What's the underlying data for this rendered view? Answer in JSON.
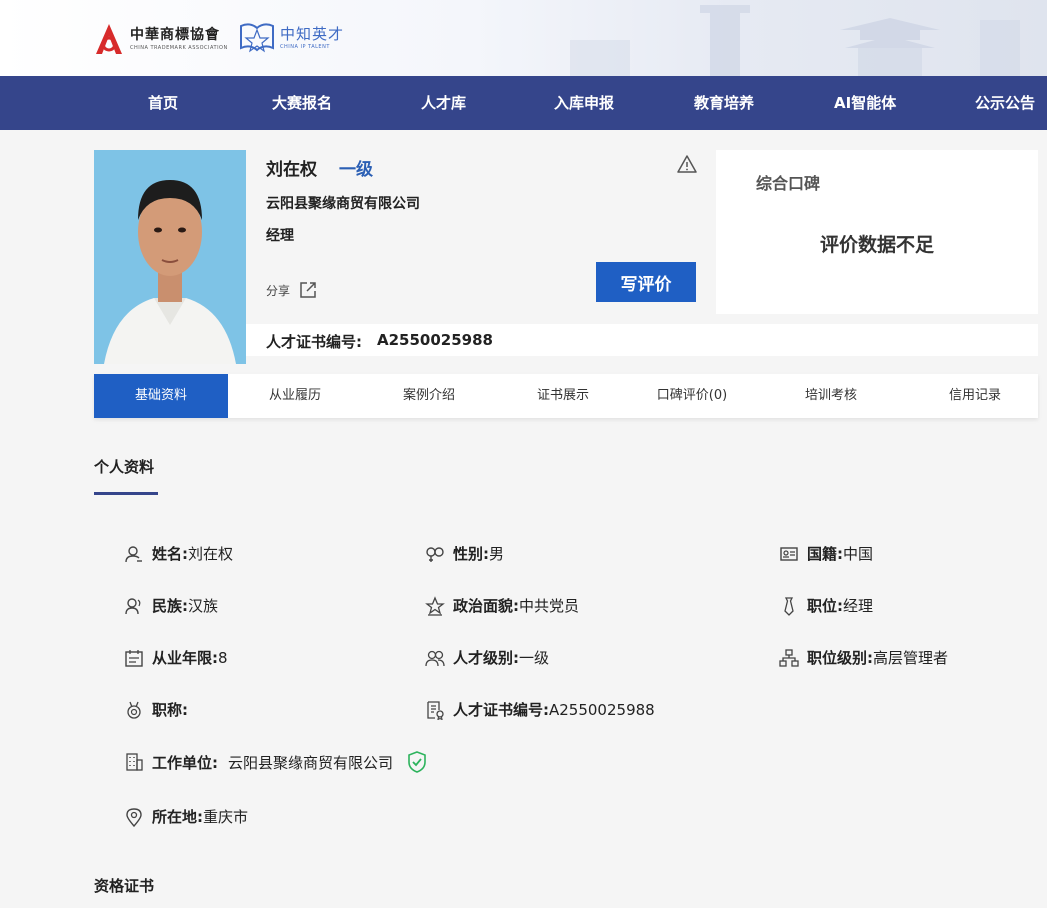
{
  "header": {
    "logo1_cn": "中華商標協會",
    "logo1_en": "CHINA TRADEMARK ASSOCIATION",
    "logo2_cn": "中知英才",
    "logo2_en": "CHINA IP TALENT"
  },
  "nav": {
    "items": [
      "首页",
      "大赛报名",
      "人才库",
      "入库申报",
      "教育培养",
      "AI智能体",
      "公示公告"
    ]
  },
  "profile": {
    "name": "刘在权",
    "level": "一级",
    "company": "云阳县聚缘商贸有限公司",
    "position": "经理",
    "share_label": "分享",
    "review_button": "写评价",
    "cert_label": "人才证书编号:",
    "cert_number": "A2550025988"
  },
  "reputation": {
    "title": "综合口碑",
    "message": "评价数据不足"
  },
  "tabs": [
    "基础资料",
    "从业履历",
    "案例介绍",
    "证书展示",
    "口碑评价(0)",
    "培训考核",
    "信用记录"
  ],
  "active_tab": "基础资料",
  "personal": {
    "section_title": "个人资料",
    "fields": {
      "name": {
        "label": "姓名:",
        "value": "刘在权",
        "icon": "user-icon"
      },
      "gender": {
        "label": "性别:",
        "value": "男",
        "icon": "gender-icon"
      },
      "nationality": {
        "label": "国籍:",
        "value": "中国",
        "icon": "id-card-icon"
      },
      "ethnicity": {
        "label": "民族:",
        "value": "汉族",
        "icon": "people-icon"
      },
      "political": {
        "label": "政治面貌:",
        "value": "中共党员",
        "icon": "star-icon"
      },
      "job": {
        "label": "职位:",
        "value": "经理",
        "icon": "tie-icon"
      },
      "years": {
        "label": "从业年限:",
        "value": "8",
        "icon": "calendar-icon"
      },
      "talent_level": {
        "label": "人才级别:",
        "value": "一级",
        "icon": "group-icon"
      },
      "job_level": {
        "label": "职位级别:",
        "value": "高层管理者",
        "icon": "org-chart-icon"
      },
      "title": {
        "label": "职称:",
        "value": "",
        "icon": "medal-icon"
      },
      "cert": {
        "label": "人才证书编号:",
        "value": "A2550025988",
        "icon": "certificate-icon"
      },
      "employer": {
        "label": "工作单位:",
        "value": "云阳县聚缘商贸有限公司",
        "icon": "building-icon"
      },
      "location": {
        "label": "所在地:",
        "value": "重庆市",
        "icon": "location-icon"
      }
    }
  },
  "qualification": {
    "section_title": "资格证书"
  },
  "colors": {
    "nav_bg": "#35458b",
    "primary_blue": "#1f5fc4",
    "level_blue": "#2b5fb4",
    "verified_green": "#2db35d"
  }
}
